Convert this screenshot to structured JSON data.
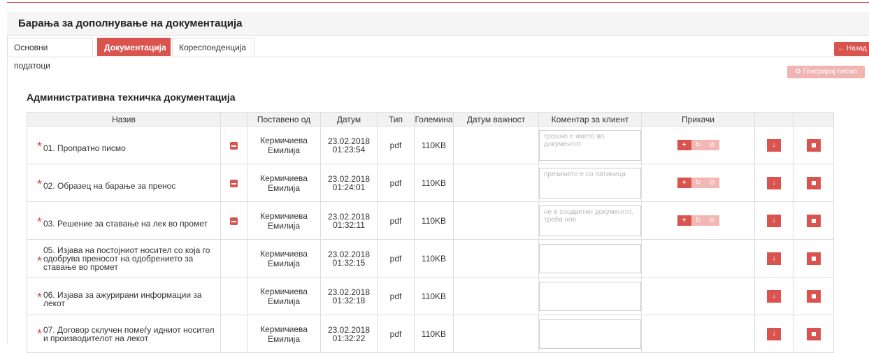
{
  "panel": {
    "title": "Барања за дополнување на документација"
  },
  "tabs": [
    {
      "label": "Основни податоци"
    },
    {
      "label": "Документација"
    },
    {
      "label": "Кореспонденција"
    }
  ],
  "buttons": {
    "back_label": "← Назад",
    "generate_label": "⚙ Генерирај писмо"
  },
  "section": {
    "title": "Административна техничка документација"
  },
  "table": {
    "headers": [
      "Назив",
      "",
      "Поставено од",
      "Датум",
      "Тип",
      "Големина",
      "Датум важност",
      "Коментар за клиент",
      "Прикачи",
      "",
      ""
    ],
    "rows": [
      {
        "name": "01. Пропратно писмо",
        "posted_by": "Кермичиева Емилија",
        "date": "23.02.2018",
        "time": "01:23:54",
        "type": "pdf",
        "size": "110KB",
        "comment": "грешно е името во документот"
      },
      {
        "name": "02. Образец на барање за пренос",
        "posted_by": "Кермичиева Емилија",
        "date": "23.02.2018",
        "time": "01:24:01",
        "type": "pdf",
        "size": "110KB",
        "comment": "презимето е со латиница"
      },
      {
        "name": "03. Решение за ставање на лек во промет",
        "posted_by": "Кермичиева Емилија",
        "date": "23.02.2018",
        "time": "01:32:11",
        "type": "pdf",
        "size": "110KB",
        "comment": "не е соодветен документот, треба нов"
      },
      {
        "name": "05. Изјава на постојниот носител со која го одобрува преносот на одобрението за ставање во промет",
        "posted_by": "Кермичиева Емилија",
        "date": "23.02.2018",
        "time": "01:32:15",
        "type": "pdf",
        "size": "110KB",
        "comment": ""
      },
      {
        "name": "06. Изјава за ажурирани информации за лекот",
        "posted_by": "Кермичиева Емилија",
        "date": "23.02.2018",
        "time": "01:32:18",
        "type": "pdf",
        "size": "110KB",
        "comment": ""
      },
      {
        "name": "07. Договор склучен помеѓу идниот носител и производителот на лекот",
        "posted_by": "Кермичиева Емилија",
        "date": "23.02.2018",
        "time": "01:32:22",
        "type": "pdf",
        "size": "110KB",
        "comment": ""
      }
    ]
  },
  "colors": {
    "accent": "#d9534f",
    "accent_muted": "#f2b6b3"
  }
}
